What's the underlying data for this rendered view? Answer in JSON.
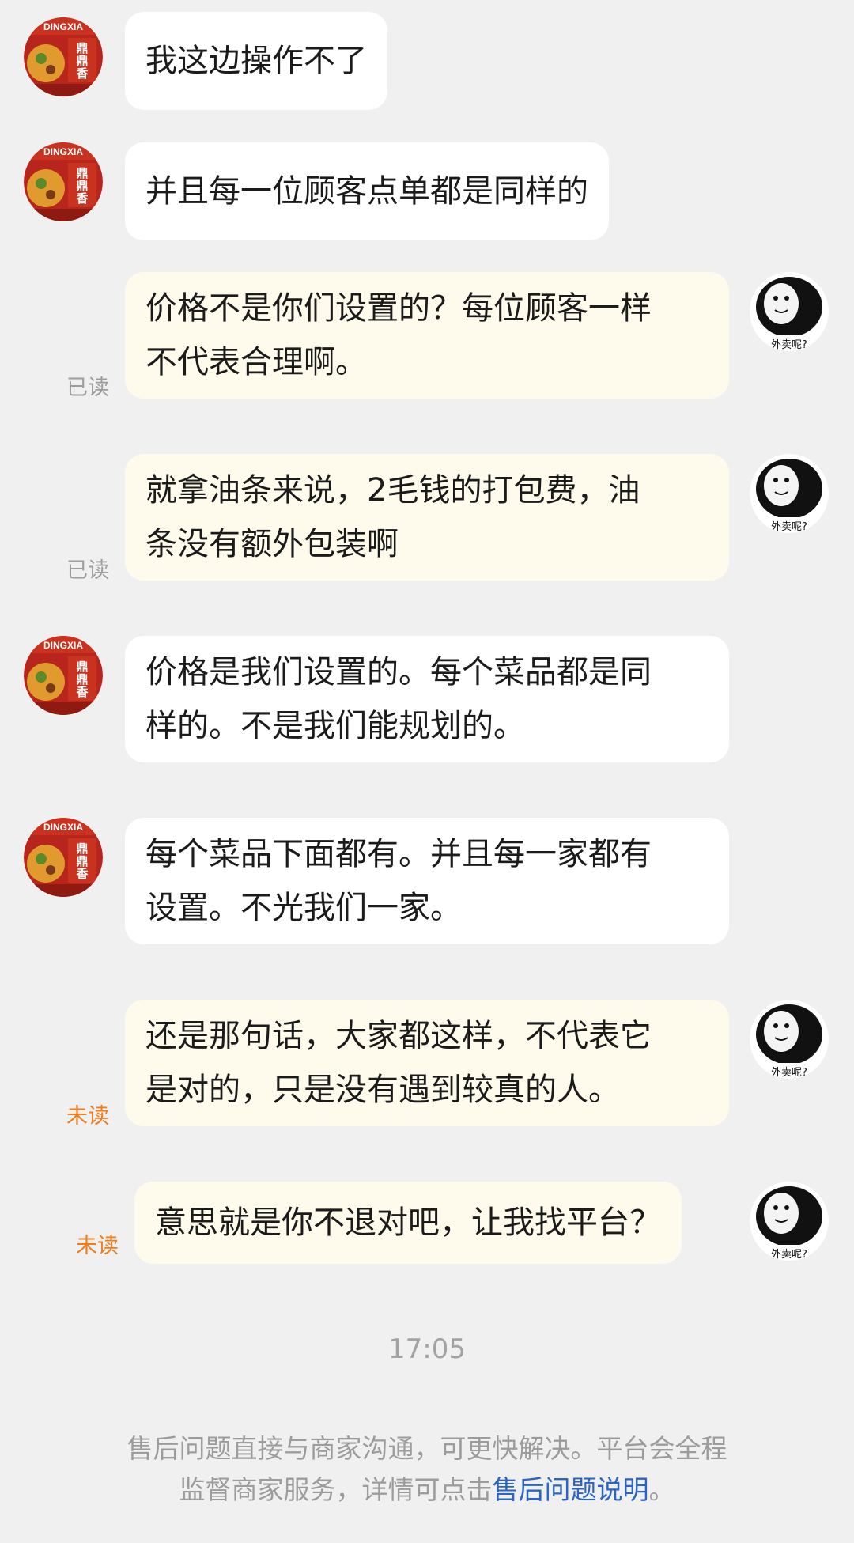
{
  "messages": [
    {
      "side": "in",
      "lines": [
        "我这边操作不了"
      ]
    },
    {
      "side": "in",
      "lines": [
        "并且每一位顾客点单都是同样的"
      ]
    },
    {
      "side": "out",
      "lines": [
        "价格不是你们设置的？每位顾客一样",
        "不代表合理啊。"
      ],
      "status": "已读"
    },
    {
      "side": "out",
      "lines": [
        "就拿油条来说，2毛钱的打包费，油",
        "条没有额外包装啊"
      ],
      "status": "已读"
    },
    {
      "side": "in",
      "lines": [
        "价格是我们设置的。每个菜品都是同",
        "样的。不是我们能规划的。"
      ]
    },
    {
      "side": "in",
      "lines": [
        "每个菜品下面都有。并且每一家都有",
        "设置。不光我们一家。"
      ]
    },
    {
      "side": "out",
      "lines": [
        "还是那句话，大家都这样，不代表它",
        "是对的，只是没有遇到较真的人。"
      ],
      "status": "未读"
    },
    {
      "side": "out",
      "lines": [
        "意思就是你不退对吧，让我找平台？"
      ],
      "status": "未读"
    }
  ],
  "avatars": {
    "shop": {
      "icon": "shop-logo-icon",
      "text": "DINGDINGXIANG"
    },
    "user": {
      "icon": "meme-face-icon",
      "caption": "外卖呢?"
    }
  },
  "timestamp": "17:05",
  "notice": {
    "line1": "售后问题直接与商家沟通，可更快解决。平台会全程",
    "line2_prefix": "监督商家服务，详情可点击",
    "link": "售后问题说明",
    "line2_suffix": "。"
  },
  "colors": {
    "background": "#f0f0f0",
    "incoming_bubble": "#ffffff",
    "outgoing_bubble": "#fefbed",
    "read_status": "#9d9d9d",
    "unread_status": "#f07c1c",
    "link": "#2a65c4"
  }
}
